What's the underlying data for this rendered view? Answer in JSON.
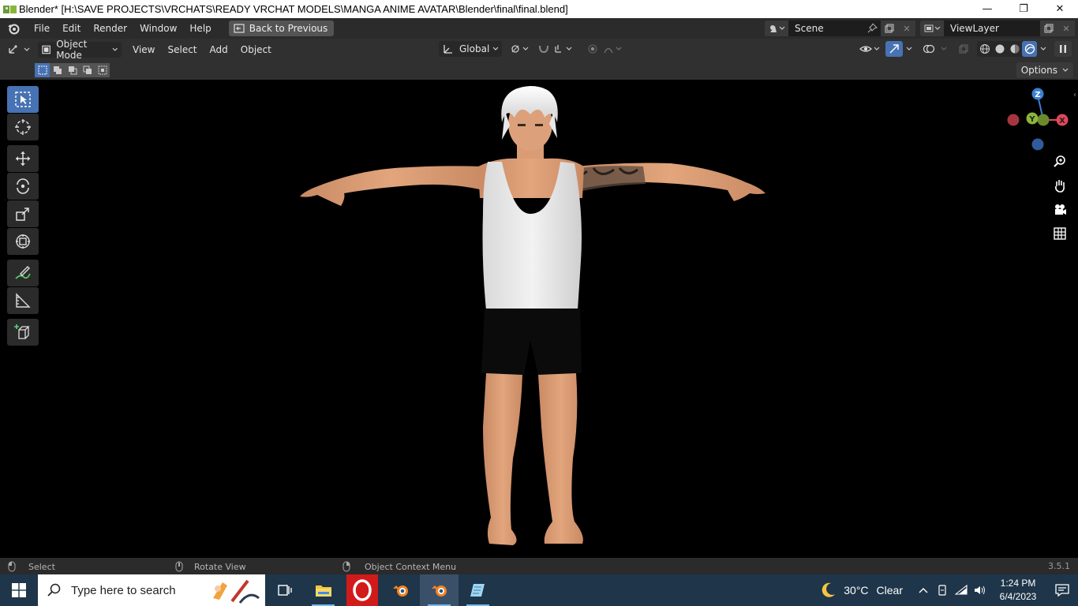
{
  "window": {
    "title": "Blender* [H:\\SAVE PROJECTS\\VRCHATS\\READY VRCHAT MODELS\\MANGA ANIME AVATAR\\Blender\\final\\final.blend]",
    "minimize": "—",
    "maximize": "❐",
    "close": "✕"
  },
  "menubar": {
    "items": [
      "File",
      "Edit",
      "Render",
      "Window",
      "Help"
    ],
    "back_button": "Back to Previous",
    "scene": "Scene",
    "view_layer": "ViewLayer"
  },
  "viewport_header": {
    "mode": "Object Mode",
    "menus": [
      "View",
      "Select",
      "Add",
      "Object"
    ],
    "orientation": "Global",
    "shading_active": "rendered"
  },
  "tool_settings": {
    "options_label": "Options",
    "selection_mode_active": "set"
  },
  "toolbar": {
    "tools": [
      "select-box",
      "cursor",
      "move",
      "rotate",
      "scale",
      "transform",
      "annotate",
      "measure",
      "add-cube"
    ],
    "active": "select-box"
  },
  "gizmo": {
    "axes": {
      "z": "Z",
      "y": "Y",
      "x": "X"
    },
    "colors": {
      "x": "#e0485b",
      "y": "#8ab53b",
      "z": "#3d7fd4"
    }
  },
  "statusbar": {
    "select": "Select",
    "rotate_view": "Rotate View",
    "context_menu": "Object Context Menu",
    "version": "3.5.1"
  },
  "taskbar": {
    "search_placeholder": "Type here to search",
    "apps": [
      "task-view",
      "file-explorer",
      "opera",
      "blender",
      "blender-active",
      "notepad"
    ],
    "weather_temp": "30°C",
    "weather_desc": "Clear",
    "time": "1:24 PM",
    "date": "6/4/2023"
  },
  "colors": {
    "accent": "#4772b3",
    "header_bg": "#303030",
    "taskbar_bg": "#1f3549"
  }
}
